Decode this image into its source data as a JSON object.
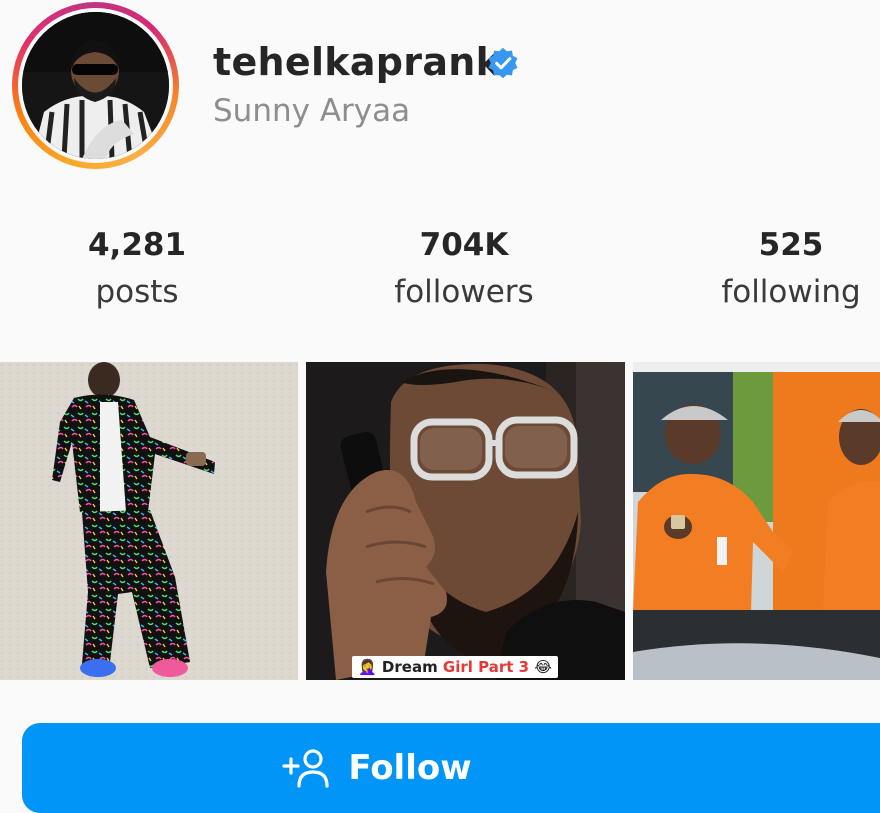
{
  "profile": {
    "username": "tehelkaprank",
    "full_name": "Sunny Aryaa",
    "verified": true,
    "avatar_icon": "profile-photo"
  },
  "stats": [
    {
      "value": "4,281",
      "label": "posts"
    },
    {
      "value": "704K",
      "label": "followers"
    },
    {
      "value": "525",
      "label": "following"
    }
  ],
  "posts": [
    {
      "icon": "photo-man-patterned-outfit"
    },
    {
      "icon": "photo-man-on-phone",
      "caption_emoji_left": "🤦‍♀️",
      "caption_a": "Dream ",
      "caption_b": "Girl Part 3",
      "caption_emoji_right": "😂"
    },
    {
      "icon": "photo-workers-orange-uniform"
    }
  ],
  "follow_button": {
    "label": "Follow",
    "icon": "add-person-icon"
  },
  "colors": {
    "accent": "#0095f6",
    "verified": "#3897f0",
    "muted_text": "#8e8e8e"
  }
}
